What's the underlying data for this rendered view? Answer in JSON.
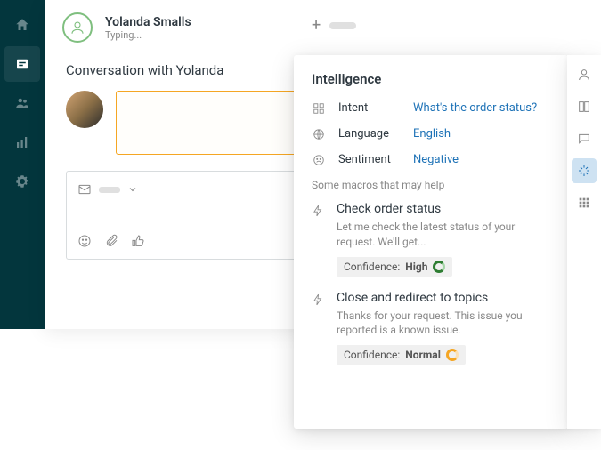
{
  "header": {
    "name": "Yolanda Smalls",
    "status": "Typing..."
  },
  "conversation": {
    "title": "Conversation with Yolanda"
  },
  "intelligence": {
    "title": "Intelligence",
    "intent_label": "Intent",
    "intent_value": "What's the order status?",
    "language_label": "Language",
    "language_value": "English",
    "sentiment_label": "Sentiment",
    "sentiment_value": "Negative",
    "macro_hint": "Some macros that may help"
  },
  "macros": [
    {
      "title": "Check order status",
      "desc": "Let me check the latest status of your request. We'll get...",
      "confidence_label": "Confidence:",
      "confidence_value": "High",
      "confidence_ring": "green"
    },
    {
      "title": "Close and redirect to topics",
      "desc": "Thanks for your request. This issue you reported is a known issue.",
      "confidence_label": "Confidence:",
      "confidence_value": "Normal",
      "confidence_ring": "orange"
    }
  ]
}
